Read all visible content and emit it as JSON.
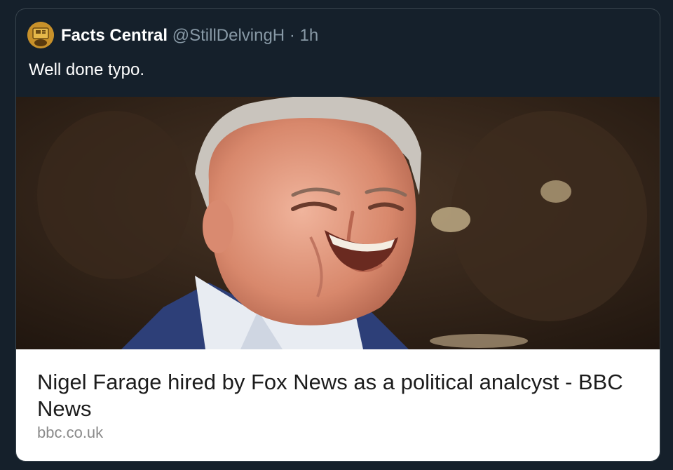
{
  "tweet": {
    "display_name": "Facts Central",
    "handle": "@StillDelvingH",
    "separator": "·",
    "time": "1h",
    "text": "Well done typo.",
    "avatar_icon": "emoji-avatar-icon"
  },
  "link_card": {
    "title": "Nigel Farage hired by Fox News as a political analcyst - BBC News",
    "domain": "bbc.co.uk"
  },
  "colors": {
    "background": "#15202b",
    "border": "#38444d",
    "text_primary": "#ffffff",
    "text_secondary": "#8899a6",
    "card_background": "#ffffff"
  }
}
